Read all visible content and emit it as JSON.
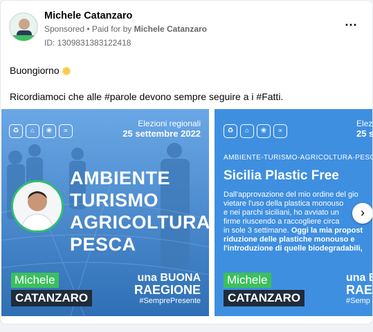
{
  "post": {
    "page_name": "Michele Catanzaro",
    "sponsored": "Sponsored",
    "paid_for_by_prefix": "• Paid for by",
    "paid_for_by": "Michele Catanzaro",
    "ad_id": "ID: 1309831383122418",
    "line1": "Buongiorno",
    "line2": "Ricordiamoci che alle #parole devono sempre seguire a i #Fatti.",
    "more_icon": "⋯",
    "next_icon": "›"
  },
  "slide1": {
    "elezioni": "Elezioni regionali",
    "date": "25 settembre 2022",
    "headline": [
      "AMBIENTE",
      "TURISMO",
      "AGRICOLTURA",
      "PESCA"
    ],
    "first_name": "Michele",
    "last_name": "CATANZARO",
    "brand_top": "una BUONA",
    "brand_bottom": "RAEGIONE",
    "hashtag": "#SemprePresente",
    "icons": [
      "♻",
      "⌂",
      "❀",
      "∝"
    ]
  },
  "slide2": {
    "elezioni": "Elez",
    "date": "25 s",
    "kicker": "AMBIENTE-TURISMO-AGRICOLTURA-PESCA",
    "title": "Sicilia Plastic Free",
    "body": [
      "Dall'approvazione del mio ordine del gio",
      "vietare l'uso della plastica monouso",
      "e nei parchi siciliani, ho avviato un",
      "firme riuscendo a raccogliere circa",
      "in sole 3 settimane."
    ],
    "body_bold": [
      "Oggi la mia propost",
      "riduzione delle plastiche monouso e",
      "l'introduzione di quelle biodegradabili,"
    ],
    "first_name": "Michele",
    "last_name": "CATANZARO",
    "brand_top": "una B",
    "brand_bottom": "RAEG",
    "hashtag": "#Semp",
    "icons": [
      "♻",
      "⌂",
      "❀",
      "∝"
    ]
  }
}
